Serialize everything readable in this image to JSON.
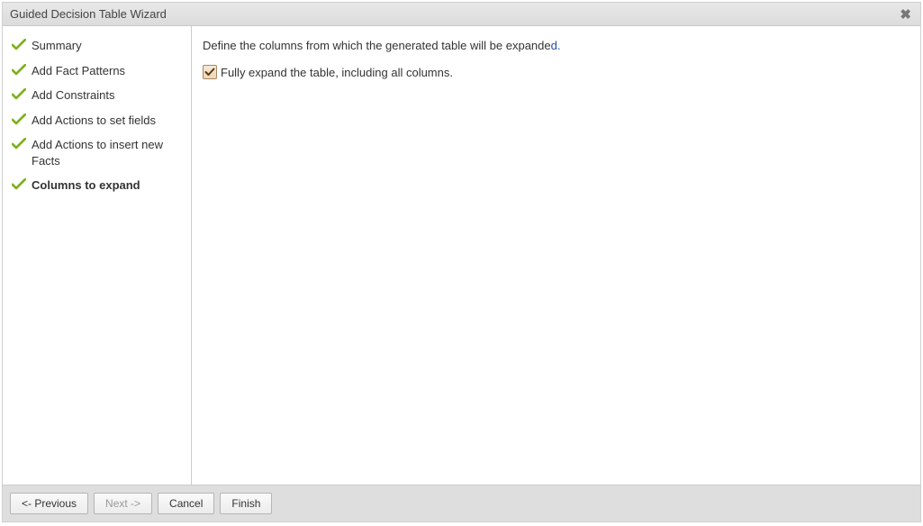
{
  "dialog": {
    "title": "Guided Decision Table Wizard"
  },
  "sidebar": {
    "steps": [
      {
        "label": "Summary"
      },
      {
        "label": "Add Fact Patterns"
      },
      {
        "label": "Add Constraints"
      },
      {
        "label": "Add Actions to set fields"
      },
      {
        "label": "Add Actions to insert new Facts"
      },
      {
        "label": "Columns to expand"
      }
    ],
    "current_index": 5
  },
  "content": {
    "description_prefix": "Define the columns from which the generated table will be expande",
    "description_suffix": "d.",
    "fully_expand_label": "Fully expand the table, including all columns.",
    "fully_expand_checked": true
  },
  "footer": {
    "previous": "<- Previous",
    "next": "Next ->",
    "cancel": "Cancel",
    "finish": "Finish",
    "next_enabled": false
  },
  "colors": {
    "check_green": "#9aca3c",
    "check_dark": "#6f9a20"
  }
}
